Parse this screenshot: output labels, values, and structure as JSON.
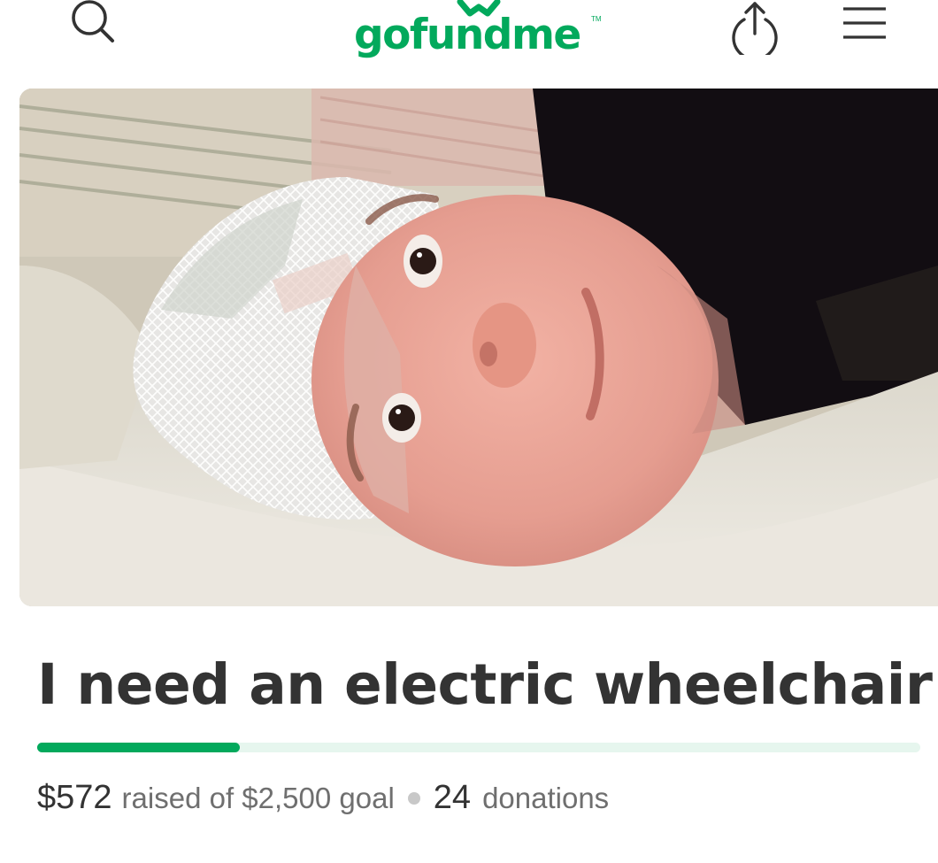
{
  "header": {
    "logo_text": "gofundme",
    "logo_tm": "TM",
    "icons": [
      "search-icon",
      "share-icon",
      "menu-icon"
    ]
  },
  "campaign": {
    "title": "I need an electric wheelchair",
    "raised_amount": "$572",
    "raised_text": "raised of $2,500 goal",
    "donation_count": "24",
    "donation_text": "donations",
    "progress_fraction": 0.229
  },
  "colors": {
    "brand": "#02a95c",
    "progress_track": "#e6f6ee",
    "text_dark": "#333333",
    "text_muted": "#6f6f6f"
  }
}
